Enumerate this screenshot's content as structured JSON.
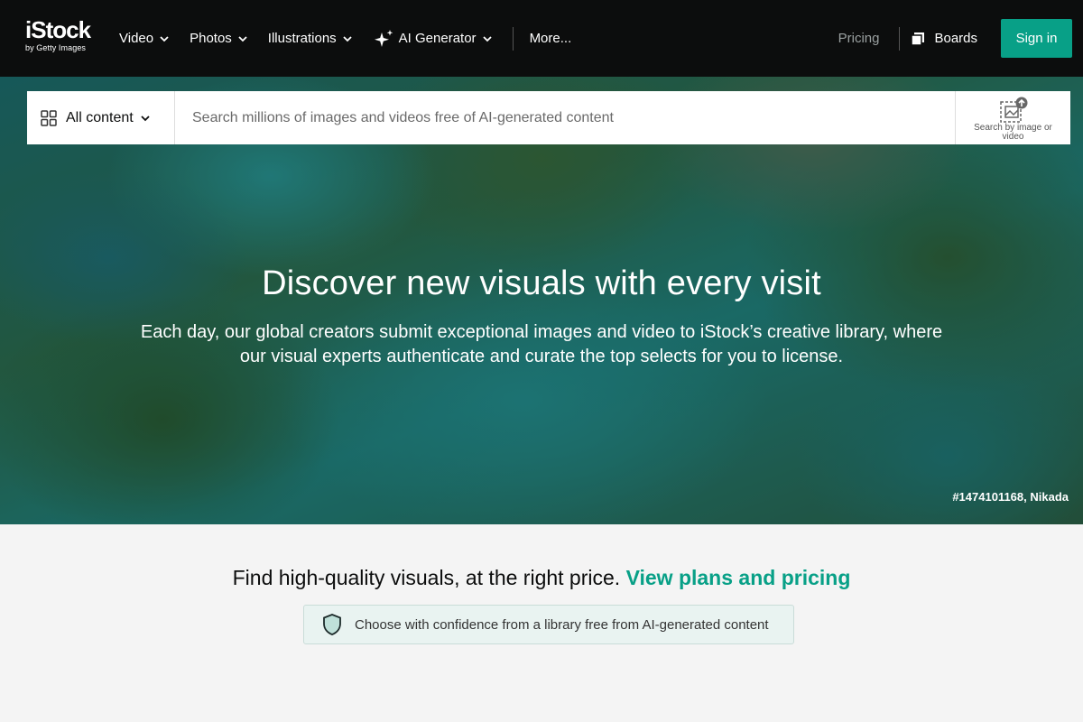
{
  "brand": {
    "logo_word": "iStock",
    "logo_sub": "by Getty Images"
  },
  "nav": {
    "items": [
      {
        "label": "Video",
        "dropdown": true
      },
      {
        "label": "Photos",
        "dropdown": true
      },
      {
        "label": "Illustrations",
        "dropdown": true
      },
      {
        "label": "AI Generator",
        "dropdown": true,
        "icon": "sparkle-icon"
      }
    ],
    "more_label": "More...",
    "pricing_label": "Pricing",
    "boards_label": "Boards",
    "signin_label": "Sign in"
  },
  "search": {
    "content_type": "All content",
    "placeholder": "Search millions of images and videos free of AI-generated content",
    "image_search_label": "Search by image or video"
  },
  "hero": {
    "title": "Discover new visuals with every visit",
    "subtitle": "Each day, our global creators submit exceptional images and video to iStock’s creative library, where our visual experts authenticate and curate the top selects for you to license.",
    "credit": "#1474101168, Nikada"
  },
  "promo": {
    "text": "Find high-quality visuals, at the right price.",
    "link": "View plans and pricing",
    "badge_text": "Choose with confidence from a library free from AI-generated content",
    "badge_icon": "shield-icon"
  },
  "colors": {
    "accent": "#08a087",
    "nav_bg": "#0c0d0d",
    "page_bg": "#f4f4f4"
  }
}
